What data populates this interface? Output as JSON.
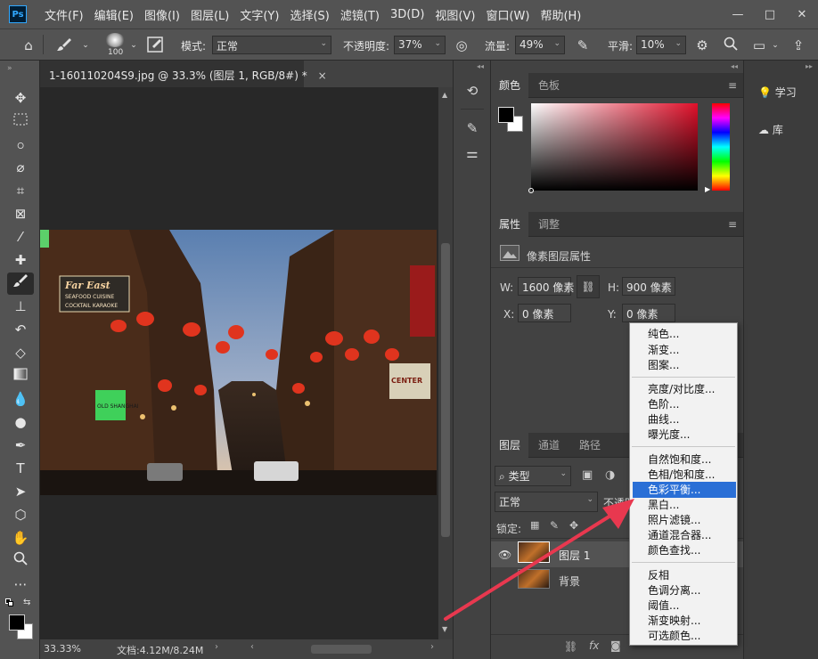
{
  "menubar": {
    "logo": "Ps",
    "items": [
      "文件(F)",
      "编辑(E)",
      "图像(I)",
      "图层(L)",
      "文字(Y)",
      "选择(S)",
      "滤镜(T)",
      "3D(D)",
      "视图(V)",
      "窗口(W)",
      "帮助(H)"
    ],
    "window_controls": [
      "—",
      "□",
      "✕"
    ]
  },
  "options": {
    "brush_size": "100",
    "mode_label": "模式:",
    "mode_value": "正常",
    "opacity_label": "不透明度:",
    "opacity_value": "37%",
    "flow_label": "流量:",
    "flow_value": "49%",
    "smooth_label": "平滑:",
    "smooth_value": "10%"
  },
  "document": {
    "tab_title": "1-160110204S9.jpg @ 33.3% (图层 1, RGB/8#) *",
    "close": "×",
    "zoom": "33.33%",
    "doc_info": "文档:4.12M/8.24M"
  },
  "color_panel": {
    "tabs": [
      "颜色",
      "色板"
    ],
    "foreground": "#000000",
    "background": "#ffffff",
    "hue_base": "#e0102a"
  },
  "properties_panel": {
    "tabs": [
      "属性",
      "调整"
    ],
    "header": "像素图层属性",
    "w_label": "W:",
    "w_value": "1600 像素",
    "h_label": "H:",
    "h_value": "900 像素",
    "x_label": "X:",
    "x_value": "0 像素",
    "y_label": "Y:",
    "y_value": "0 像素"
  },
  "layers_panel": {
    "tabs": [
      "图层",
      "通道",
      "路径"
    ],
    "filter_label": "类型",
    "blend_mode": "正常",
    "opacity_label": "不透明",
    "lock_label": "锁定:",
    "layers": [
      {
        "name": "图层 1",
        "visible": true
      },
      {
        "name": "背景",
        "visible": false
      }
    ]
  },
  "right_column": {
    "learn": "学习",
    "library": "库"
  },
  "context_menu": {
    "groups": [
      [
        "纯色...",
        "渐变...",
        "图案..."
      ],
      [
        "亮度/对比度...",
        "色阶...",
        "曲线...",
        "曝光度..."
      ],
      [
        "自然饱和度...",
        "色相/饱和度...",
        "色彩平衡...",
        "黑白...",
        "照片滤镜...",
        "通道混合器...",
        "颜色查找..."
      ],
      [
        "反相",
        "色调分离...",
        "阈值...",
        "渐变映射...",
        "可选颜色..."
      ]
    ],
    "highlighted": "色彩平衡..."
  },
  "colors": {
    "highlight": "#2a6fd6",
    "arrow": "#e8384f"
  }
}
